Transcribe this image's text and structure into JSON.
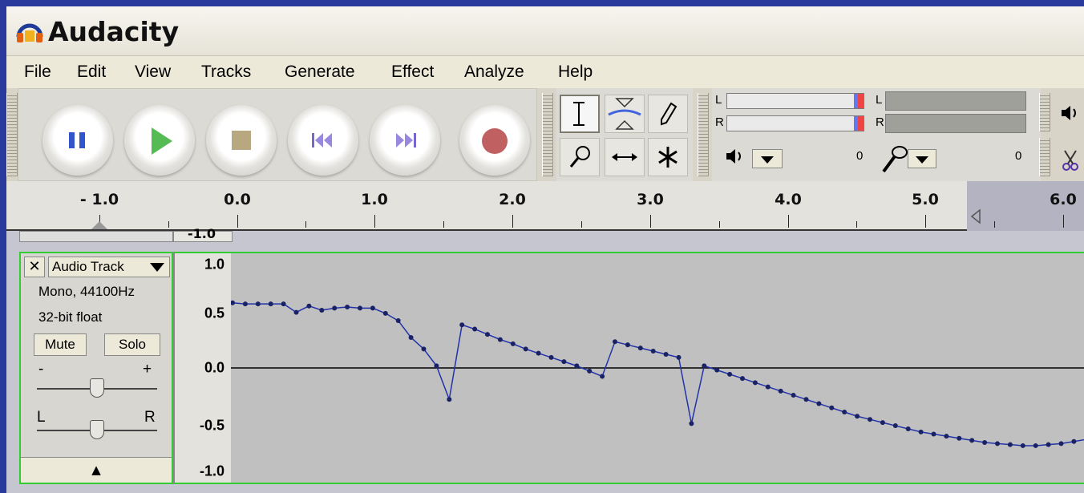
{
  "window": {
    "title": "Audacity"
  },
  "menu": {
    "items": [
      "File",
      "Edit",
      "View",
      "Tracks",
      "Generate",
      "Effect",
      "Analyze",
      "Help"
    ]
  },
  "transport": {
    "buttons": [
      "pause",
      "play",
      "stop",
      "skip-to-start",
      "skip-to-end",
      "record"
    ]
  },
  "tools": {
    "items": [
      "selection-tool",
      "envelope-tool",
      "draw-tool",
      "zoom-tool",
      "time-shift-tool",
      "multi-tool"
    ],
    "active": "selection-tool"
  },
  "meters": {
    "playback": {
      "left_label": "L",
      "right_label": "R",
      "zero_label": "0"
    },
    "record": {
      "left_label": "L",
      "right_label": "R",
      "zero_label": "0"
    }
  },
  "ruler": {
    "labels": [
      "- 1.0",
      "0.0",
      "1.0",
      "2.0",
      "3.0",
      "4.0",
      "5.0",
      "6.0"
    ]
  },
  "upper_track": {
    "scale_label": "-1.0"
  },
  "track": {
    "name": "Audio Track",
    "close_label": "✕",
    "info_rate": "Mono, 44100Hz",
    "info_format": "32-bit float",
    "mute_label": "Mute",
    "solo_label": "Solo",
    "gain_minus": "-",
    "gain_plus": "+",
    "pan_left": "L",
    "pan_right": "R",
    "collapse_label": "▲",
    "gain_value": 0.5,
    "pan_value": 0.5
  },
  "vscale": {
    "labels": [
      "1.0",
      "0.5",
      "0.0",
      "-0.5",
      "-1.0"
    ]
  },
  "colors": {
    "selection_border": "#33cc33",
    "waveform": "#2233aa",
    "record_button": "#c06060",
    "play_button": "#55bb55"
  },
  "waveform": {
    "samples": [
      0.62,
      0.61,
      0.61,
      0.61,
      0.61,
      0.53,
      0.59,
      0.55,
      0.57,
      0.58,
      0.57,
      0.57,
      0.52,
      0.45,
      0.29,
      0.18,
      0.02,
      -0.3,
      0.41,
      0.37,
      0.32,
      0.27,
      0.23,
      0.18,
      0.14,
      0.1,
      0.06,
      0.02,
      -0.03,
      -0.08,
      0.25,
      0.22,
      0.19,
      0.16,
      0.13,
      0.1,
      -0.53,
      0.02,
      -0.02,
      -0.06,
      -0.1,
      -0.14,
      -0.18,
      -0.22,
      -0.26,
      -0.3,
      -0.34,
      -0.38,
      -0.42,
      -0.46,
      -0.49,
      -0.52,
      -0.55,
      -0.58,
      -0.61,
      -0.63,
      -0.65,
      -0.67,
      -0.69,
      -0.71,
      -0.72,
      -0.73,
      -0.74,
      -0.74,
      -0.73,
      -0.72,
      -0.7,
      -0.68
    ]
  }
}
